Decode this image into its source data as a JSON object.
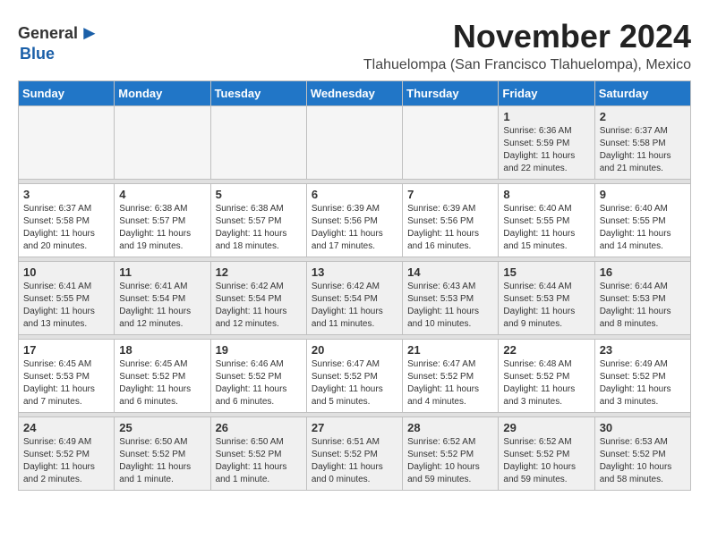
{
  "logo": {
    "general": "General",
    "blue": "Blue",
    "bird_symbol": "▶"
  },
  "title": "November 2024",
  "subtitle": "Tlahuelompa (San Francisco Tlahuelompa), Mexico",
  "days_of_week": [
    "Sunday",
    "Monday",
    "Tuesday",
    "Wednesday",
    "Thursday",
    "Friday",
    "Saturday"
  ],
  "weeks": [
    [
      {
        "day": "",
        "info": ""
      },
      {
        "day": "",
        "info": ""
      },
      {
        "day": "",
        "info": ""
      },
      {
        "day": "",
        "info": ""
      },
      {
        "day": "",
        "info": ""
      },
      {
        "day": "1",
        "info": "Sunrise: 6:36 AM\nSunset: 5:59 PM\nDaylight: 11 hours and 22 minutes."
      },
      {
        "day": "2",
        "info": "Sunrise: 6:37 AM\nSunset: 5:58 PM\nDaylight: 11 hours and 21 minutes."
      }
    ],
    [
      {
        "day": "3",
        "info": "Sunrise: 6:37 AM\nSunset: 5:58 PM\nDaylight: 11 hours and 20 minutes."
      },
      {
        "day": "4",
        "info": "Sunrise: 6:38 AM\nSunset: 5:57 PM\nDaylight: 11 hours and 19 minutes."
      },
      {
        "day": "5",
        "info": "Sunrise: 6:38 AM\nSunset: 5:57 PM\nDaylight: 11 hours and 18 minutes."
      },
      {
        "day": "6",
        "info": "Sunrise: 6:39 AM\nSunset: 5:56 PM\nDaylight: 11 hours and 17 minutes."
      },
      {
        "day": "7",
        "info": "Sunrise: 6:39 AM\nSunset: 5:56 PM\nDaylight: 11 hours and 16 minutes."
      },
      {
        "day": "8",
        "info": "Sunrise: 6:40 AM\nSunset: 5:55 PM\nDaylight: 11 hours and 15 minutes."
      },
      {
        "day": "9",
        "info": "Sunrise: 6:40 AM\nSunset: 5:55 PM\nDaylight: 11 hours and 14 minutes."
      }
    ],
    [
      {
        "day": "10",
        "info": "Sunrise: 6:41 AM\nSunset: 5:55 PM\nDaylight: 11 hours and 13 minutes."
      },
      {
        "day": "11",
        "info": "Sunrise: 6:41 AM\nSunset: 5:54 PM\nDaylight: 11 hours and 12 minutes."
      },
      {
        "day": "12",
        "info": "Sunrise: 6:42 AM\nSunset: 5:54 PM\nDaylight: 11 hours and 12 minutes."
      },
      {
        "day": "13",
        "info": "Sunrise: 6:42 AM\nSunset: 5:54 PM\nDaylight: 11 hours and 11 minutes."
      },
      {
        "day": "14",
        "info": "Sunrise: 6:43 AM\nSunset: 5:53 PM\nDaylight: 11 hours and 10 minutes."
      },
      {
        "day": "15",
        "info": "Sunrise: 6:44 AM\nSunset: 5:53 PM\nDaylight: 11 hours and 9 minutes."
      },
      {
        "day": "16",
        "info": "Sunrise: 6:44 AM\nSunset: 5:53 PM\nDaylight: 11 hours and 8 minutes."
      }
    ],
    [
      {
        "day": "17",
        "info": "Sunrise: 6:45 AM\nSunset: 5:53 PM\nDaylight: 11 hours and 7 minutes."
      },
      {
        "day": "18",
        "info": "Sunrise: 6:45 AM\nSunset: 5:52 PM\nDaylight: 11 hours and 6 minutes."
      },
      {
        "day": "19",
        "info": "Sunrise: 6:46 AM\nSunset: 5:52 PM\nDaylight: 11 hours and 6 minutes."
      },
      {
        "day": "20",
        "info": "Sunrise: 6:47 AM\nSunset: 5:52 PM\nDaylight: 11 hours and 5 minutes."
      },
      {
        "day": "21",
        "info": "Sunrise: 6:47 AM\nSunset: 5:52 PM\nDaylight: 11 hours and 4 minutes."
      },
      {
        "day": "22",
        "info": "Sunrise: 6:48 AM\nSunset: 5:52 PM\nDaylight: 11 hours and 3 minutes."
      },
      {
        "day": "23",
        "info": "Sunrise: 6:49 AM\nSunset: 5:52 PM\nDaylight: 11 hours and 3 minutes."
      }
    ],
    [
      {
        "day": "24",
        "info": "Sunrise: 6:49 AM\nSunset: 5:52 PM\nDaylight: 11 hours and 2 minutes."
      },
      {
        "day": "25",
        "info": "Sunrise: 6:50 AM\nSunset: 5:52 PM\nDaylight: 11 hours and 1 minute."
      },
      {
        "day": "26",
        "info": "Sunrise: 6:50 AM\nSunset: 5:52 PM\nDaylight: 11 hours and 1 minute."
      },
      {
        "day": "27",
        "info": "Sunrise: 6:51 AM\nSunset: 5:52 PM\nDaylight: 11 hours and 0 minutes."
      },
      {
        "day": "28",
        "info": "Sunrise: 6:52 AM\nSunset: 5:52 PM\nDaylight: 10 hours and 59 minutes."
      },
      {
        "day": "29",
        "info": "Sunrise: 6:52 AM\nSunset: 5:52 PM\nDaylight: 10 hours and 59 minutes."
      },
      {
        "day": "30",
        "info": "Sunrise: 6:53 AM\nSunset: 5:52 PM\nDaylight: 10 hours and 58 minutes."
      }
    ]
  ],
  "colors": {
    "header_bg": "#2176c7",
    "header_text": "#ffffff",
    "empty_cell_bg": "#f5f5f5",
    "shaded_row_bg": "#f0f0f0"
  }
}
